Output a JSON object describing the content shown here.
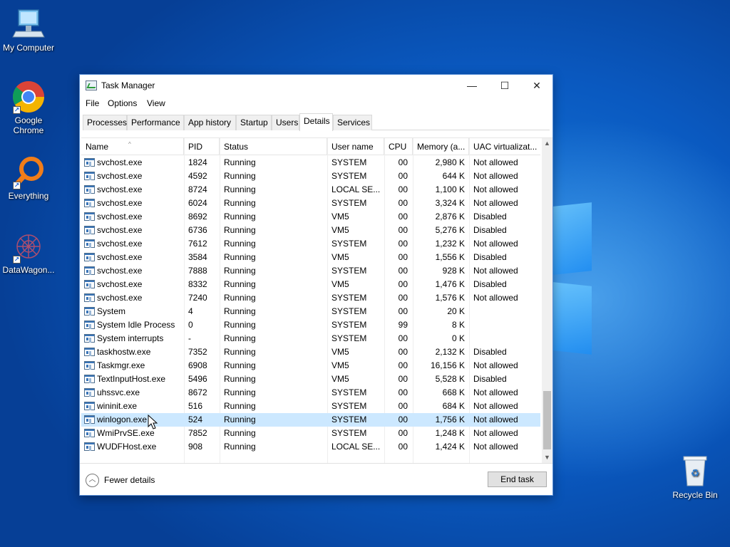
{
  "desktop": {
    "icons": [
      {
        "label": "My Computer"
      },
      {
        "label": "Google Chrome"
      },
      {
        "label": "Everything"
      },
      {
        "label": "DataWagon..."
      },
      {
        "label": "Recycle Bin"
      }
    ]
  },
  "window": {
    "title": "Task Manager",
    "controls": {
      "minimize": "—",
      "maximize": "☐",
      "close": "✕"
    }
  },
  "menu": [
    "File",
    "Options",
    "View"
  ],
  "tabs": [
    {
      "label": "Processes",
      "active": false
    },
    {
      "label": "Performance",
      "active": false
    },
    {
      "label": "App history",
      "active": false
    },
    {
      "label": "Startup",
      "active": false
    },
    {
      "label": "Users",
      "active": false
    },
    {
      "label": "Details",
      "active": true
    },
    {
      "label": "Services",
      "active": false
    }
  ],
  "table": {
    "columns": [
      "Name",
      "PID",
      "Status",
      "User name",
      "CPU",
      "Memory (a...",
      "UAC virtualizat..."
    ],
    "rows": [
      [
        "svchost.exe",
        "1824",
        "Running",
        "SYSTEM",
        "00",
        "2,980 K",
        "Not allowed"
      ],
      [
        "svchost.exe",
        "4592",
        "Running",
        "SYSTEM",
        "00",
        "644 K",
        "Not allowed"
      ],
      [
        "svchost.exe",
        "8724",
        "Running",
        "LOCAL SE...",
        "00",
        "1,100 K",
        "Not allowed"
      ],
      [
        "svchost.exe",
        "6024",
        "Running",
        "SYSTEM",
        "00",
        "3,324 K",
        "Not allowed"
      ],
      [
        "svchost.exe",
        "8692",
        "Running",
        "VM5",
        "00",
        "2,876 K",
        "Disabled"
      ],
      [
        "svchost.exe",
        "6736",
        "Running",
        "VM5",
        "00",
        "5,276 K",
        "Disabled"
      ],
      [
        "svchost.exe",
        "7612",
        "Running",
        "SYSTEM",
        "00",
        "1,232 K",
        "Not allowed"
      ],
      [
        "svchost.exe",
        "3584",
        "Running",
        "VM5",
        "00",
        "1,556 K",
        "Disabled"
      ],
      [
        "svchost.exe",
        "7888",
        "Running",
        "SYSTEM",
        "00",
        "928 K",
        "Not allowed"
      ],
      [
        "svchost.exe",
        "8332",
        "Running",
        "VM5",
        "00",
        "1,476 K",
        "Disabled"
      ],
      [
        "svchost.exe",
        "7240",
        "Running",
        "SYSTEM",
        "00",
        "1,576 K",
        "Not allowed"
      ],
      [
        "System",
        "4",
        "Running",
        "SYSTEM",
        "00",
        "20 K",
        ""
      ],
      [
        "System Idle Process",
        "0",
        "Running",
        "SYSTEM",
        "99",
        "8 K",
        ""
      ],
      [
        "System interrupts",
        "-",
        "Running",
        "SYSTEM",
        "00",
        "0 K",
        ""
      ],
      [
        "taskhostw.exe",
        "7352",
        "Running",
        "VM5",
        "00",
        "2,132 K",
        "Disabled"
      ],
      [
        "Taskmgr.exe",
        "6908",
        "Running",
        "VM5",
        "00",
        "16,156 K",
        "Not allowed"
      ],
      [
        "TextInputHost.exe",
        "5496",
        "Running",
        "VM5",
        "00",
        "5,528 K",
        "Disabled"
      ],
      [
        "uhssvc.exe",
        "8672",
        "Running",
        "SYSTEM",
        "00",
        "668 K",
        "Not allowed"
      ],
      [
        "wininit.exe",
        "516",
        "Running",
        "SYSTEM",
        "00",
        "684 K",
        "Not allowed"
      ],
      [
        "winlogon.exe",
        "524",
        "Running",
        "SYSTEM",
        "00",
        "1,756 K",
        "Not allowed"
      ],
      [
        "WmiPrvSE.exe",
        "7852",
        "Running",
        "SYSTEM",
        "00",
        "1,248 K",
        "Not allowed"
      ],
      [
        "WUDFHost.exe",
        "908",
        "Running",
        "LOCAL SE...",
        "00",
        "1,424 K",
        "Not allowed"
      ]
    ],
    "selected_row": 19
  },
  "footer": {
    "fewer_details": "Fewer details",
    "end_task": "End task"
  },
  "colors": {
    "selection": "#cce8ff",
    "desktop_blue": "#0a59c0"
  }
}
